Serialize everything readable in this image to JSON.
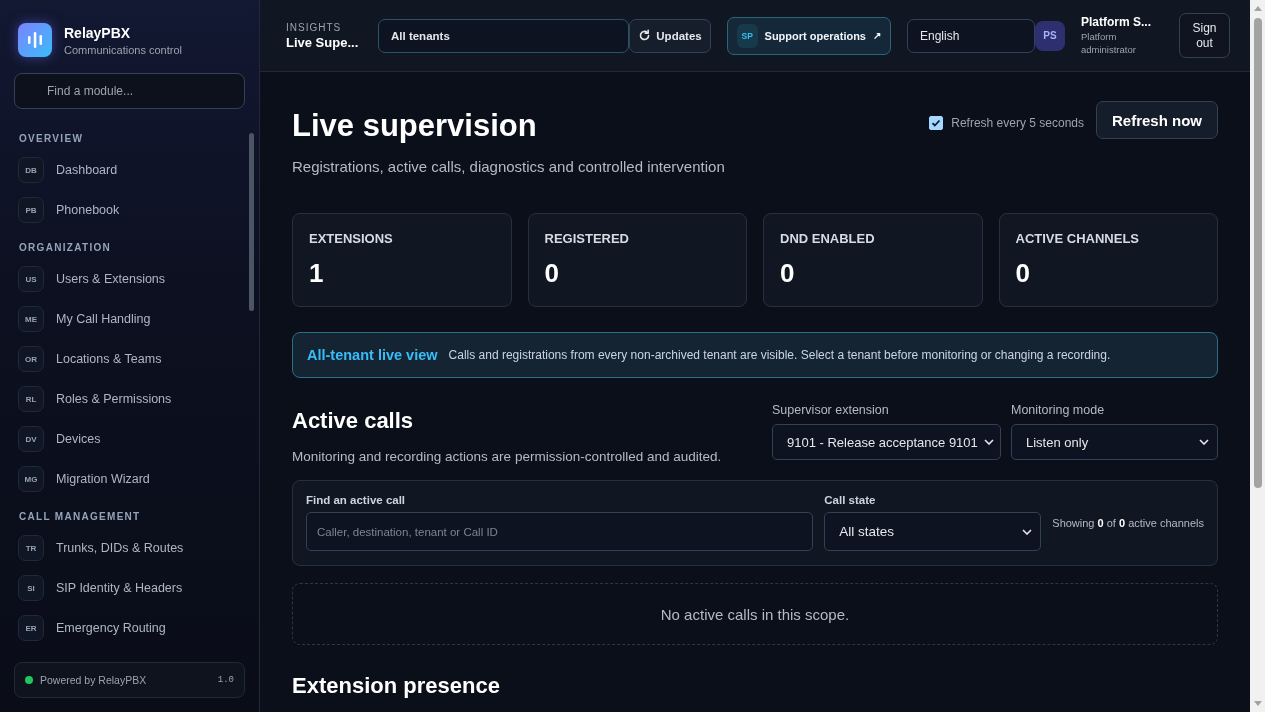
{
  "brand": {
    "name": "RelayPBX",
    "tagline": "Communications control"
  },
  "sidebar": {
    "search_placeholder": "Find a module...",
    "sections": [
      {
        "title": "OVERVIEW",
        "items": [
          {
            "badge": "DB",
            "label": "Dashboard"
          },
          {
            "badge": "PB",
            "label": "Phonebook"
          }
        ]
      },
      {
        "title": "ORGANIZATION",
        "items": [
          {
            "badge": "US",
            "label": "Users & Extensions"
          },
          {
            "badge": "ME",
            "label": "My Call Handling"
          },
          {
            "badge": "OR",
            "label": "Locations & Teams"
          },
          {
            "badge": "RL",
            "label": "Roles & Permissions"
          },
          {
            "badge": "DV",
            "label": "Devices"
          },
          {
            "badge": "MG",
            "label": "Migration Wizard"
          }
        ]
      },
      {
        "title": "CALL MANAGEMENT",
        "items": [
          {
            "badge": "TR",
            "label": "Trunks, DIDs & Routes"
          },
          {
            "badge": "SI",
            "label": "SIP Identity & Headers"
          },
          {
            "badge": "ER",
            "label": "Emergency Routing"
          }
        ]
      }
    ],
    "footer": {
      "label": "Powered by RelayPBX",
      "version": "1.0",
      "color": "#22c55e"
    }
  },
  "topbar": {
    "section": "INSIGHTS",
    "page": "Live Supe...",
    "tenant": "All tenants",
    "updates": "Updates",
    "support": {
      "badge": "SP",
      "label": "Support operations",
      "arrow": "↗"
    },
    "language": "English",
    "user": {
      "initials": "PS",
      "name": "Platform S...",
      "role": "Platform administrator"
    },
    "sign_out": "Sign out"
  },
  "header": {
    "title": "Live supervision",
    "subtitle": "Registrations, active calls, diagnostics and controlled intervention",
    "auto_refresh": {
      "label": "Refresh every 5 seconds",
      "checked": true
    },
    "refresh_button": "Refresh now"
  },
  "stats": [
    {
      "label": "EXTENSIONS",
      "value": "1"
    },
    {
      "label": "REGISTERED",
      "value": "0"
    },
    {
      "label": "DND ENABLED",
      "value": "0"
    },
    {
      "label": "ACTIVE CHANNELS",
      "value": "0"
    }
  ],
  "notice": {
    "title": "All-tenant live view",
    "text": "Calls and registrations from every non-archived tenant are visible. Select a tenant before monitoring or changing a recording."
  },
  "active_calls": {
    "title": "Active calls",
    "description": "Monitoring and recording actions are permission-controlled and audited.",
    "supervisor_extension": {
      "label": "Supervisor extension",
      "value": "9101 - Release acceptance 9101"
    },
    "monitoring_mode": {
      "label": "Monitoring mode",
      "value": "Listen only"
    },
    "filter": {
      "search_label": "Find an active call",
      "search_placeholder": "Caller, destination, tenant or Call ID",
      "state_label": "Call state",
      "state_value": "All states",
      "summary": "Showing **0** of **0** active channels"
    },
    "empty": "No active calls in this scope."
  },
  "extension_presence": {
    "title": "Extension presence"
  }
}
